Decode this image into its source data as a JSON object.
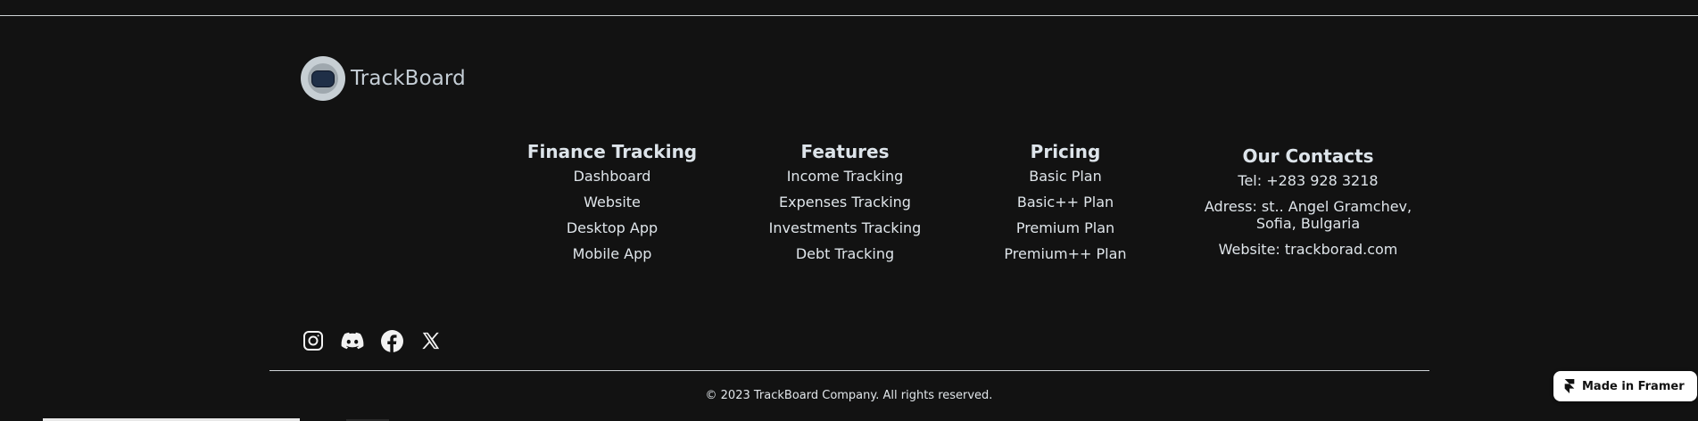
{
  "brand": {
    "name": "TrackBoard"
  },
  "columns": {
    "finance": {
      "title": "Finance Tracking",
      "items": [
        "Dashboard",
        "Website",
        "Desktop App",
        "Mobile App"
      ]
    },
    "features": {
      "title": "Features",
      "items": [
        "Income Tracking",
        "Expenses Tracking",
        "Investments Tracking",
        "Debt Tracking"
      ]
    },
    "pricing": {
      "title": "Pricing",
      "items": [
        "Basic Plan",
        "Basic++ Plan",
        "Premium Plan",
        "Premium++ Plan"
      ]
    },
    "contacts": {
      "title": "Our Contacts",
      "tel": "Tel: +283 928 3218",
      "address_line1": "Adress: st.. Angel Gramchev,",
      "address_line2": "Sofia, Bulgaria",
      "website": "Website: trackborad.com"
    }
  },
  "social": {
    "icons": [
      "instagram-icon",
      "discord-icon",
      "facebook-icon",
      "x-icon"
    ]
  },
  "footer": {
    "copyright": "© 2023 TrackBoard Company. All rights reserved."
  },
  "framer_badge": {
    "label": "Made in Framer"
  },
  "colors": {
    "background": "#121212",
    "text": "#dfe5ea",
    "rule": "#cfd3d6",
    "badge_bg": "#ffffff"
  }
}
